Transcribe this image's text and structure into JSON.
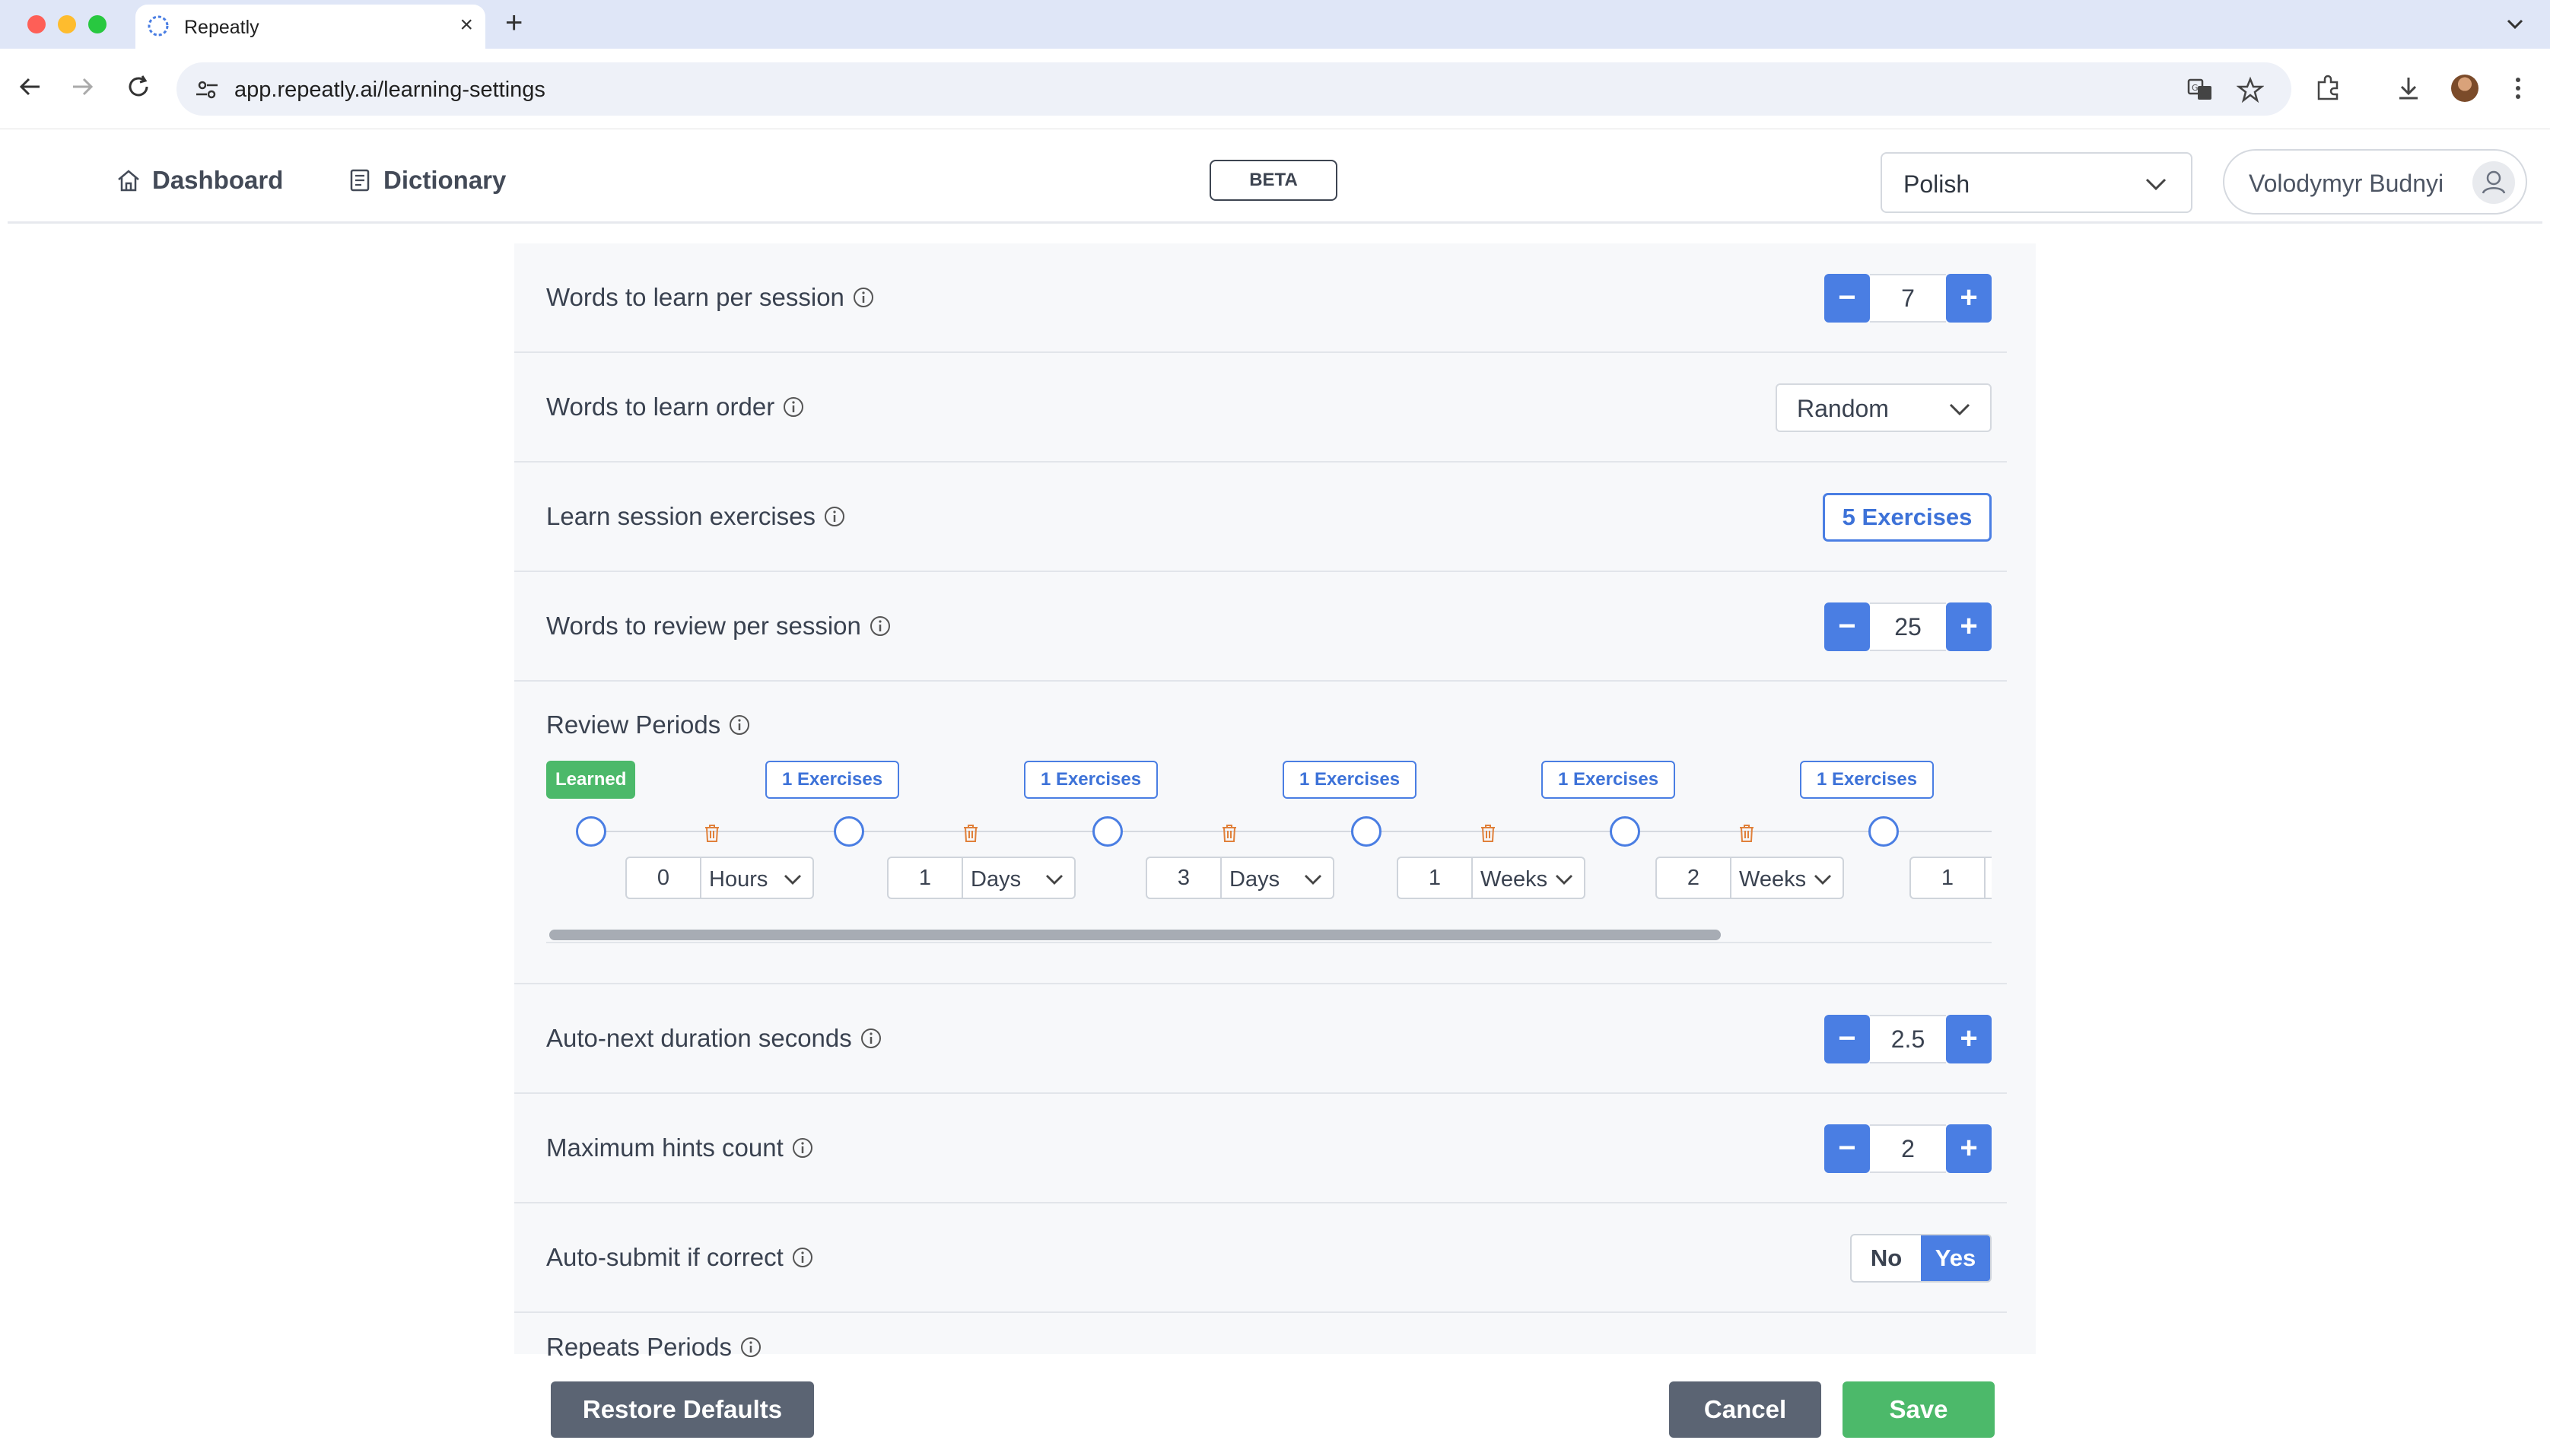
{
  "browser": {
    "tab_title": "Repeatly",
    "url": "app.repeatly.ai/learning-settings",
    "new_tab": "+"
  },
  "header": {
    "nav": [
      {
        "label": "Dashboard",
        "icon": "home-icon"
      },
      {
        "label": "Dictionary",
        "icon": "book-icon"
      }
    ],
    "beta": "BETA",
    "language": "Polish",
    "user": "Volodymyr Budnyi"
  },
  "settings": {
    "words_per_session": {
      "label": "Words to learn per session",
      "value": "7"
    },
    "learn_order": {
      "label": "Words to learn order",
      "value": "Random"
    },
    "exercises": {
      "label": "Learn session exercises",
      "value": "5 Exercises"
    },
    "review_per_session": {
      "label": "Words to review per session",
      "value": "25"
    },
    "review_periods": {
      "label": "Review Periods",
      "learned_badge": "Learned",
      "stages": [
        {
          "badge": "1 Exercises",
          "amount": "0",
          "unit": "Hours"
        },
        {
          "badge": "1 Exercises",
          "amount": "1",
          "unit": "Days"
        },
        {
          "badge": "1 Exercises",
          "amount": "3",
          "unit": "Days"
        },
        {
          "badge": "1 Exercises",
          "amount": "1",
          "unit": "Weeks"
        },
        {
          "badge": "1 Exercises",
          "amount": "2",
          "unit": "Weeks"
        },
        {
          "badge": "",
          "amount": "1",
          "unit": ""
        }
      ]
    },
    "auto_next": {
      "label": "Auto-next duration seconds",
      "value": "2.5"
    },
    "max_hints": {
      "label": "Maximum hints count",
      "value": "2"
    },
    "auto_submit": {
      "label": "Auto-submit if correct",
      "options": [
        "No",
        "Yes"
      ],
      "selected": "Yes"
    },
    "repeats_periods": {
      "label": "Repeats Periods"
    }
  },
  "footer": {
    "restore": "Restore Defaults",
    "cancel": "Cancel",
    "save": "Save"
  },
  "colors": {
    "primary": "#4a7ee3",
    "success": "#4cb96a",
    "neutral_button": "#5b6473"
  }
}
